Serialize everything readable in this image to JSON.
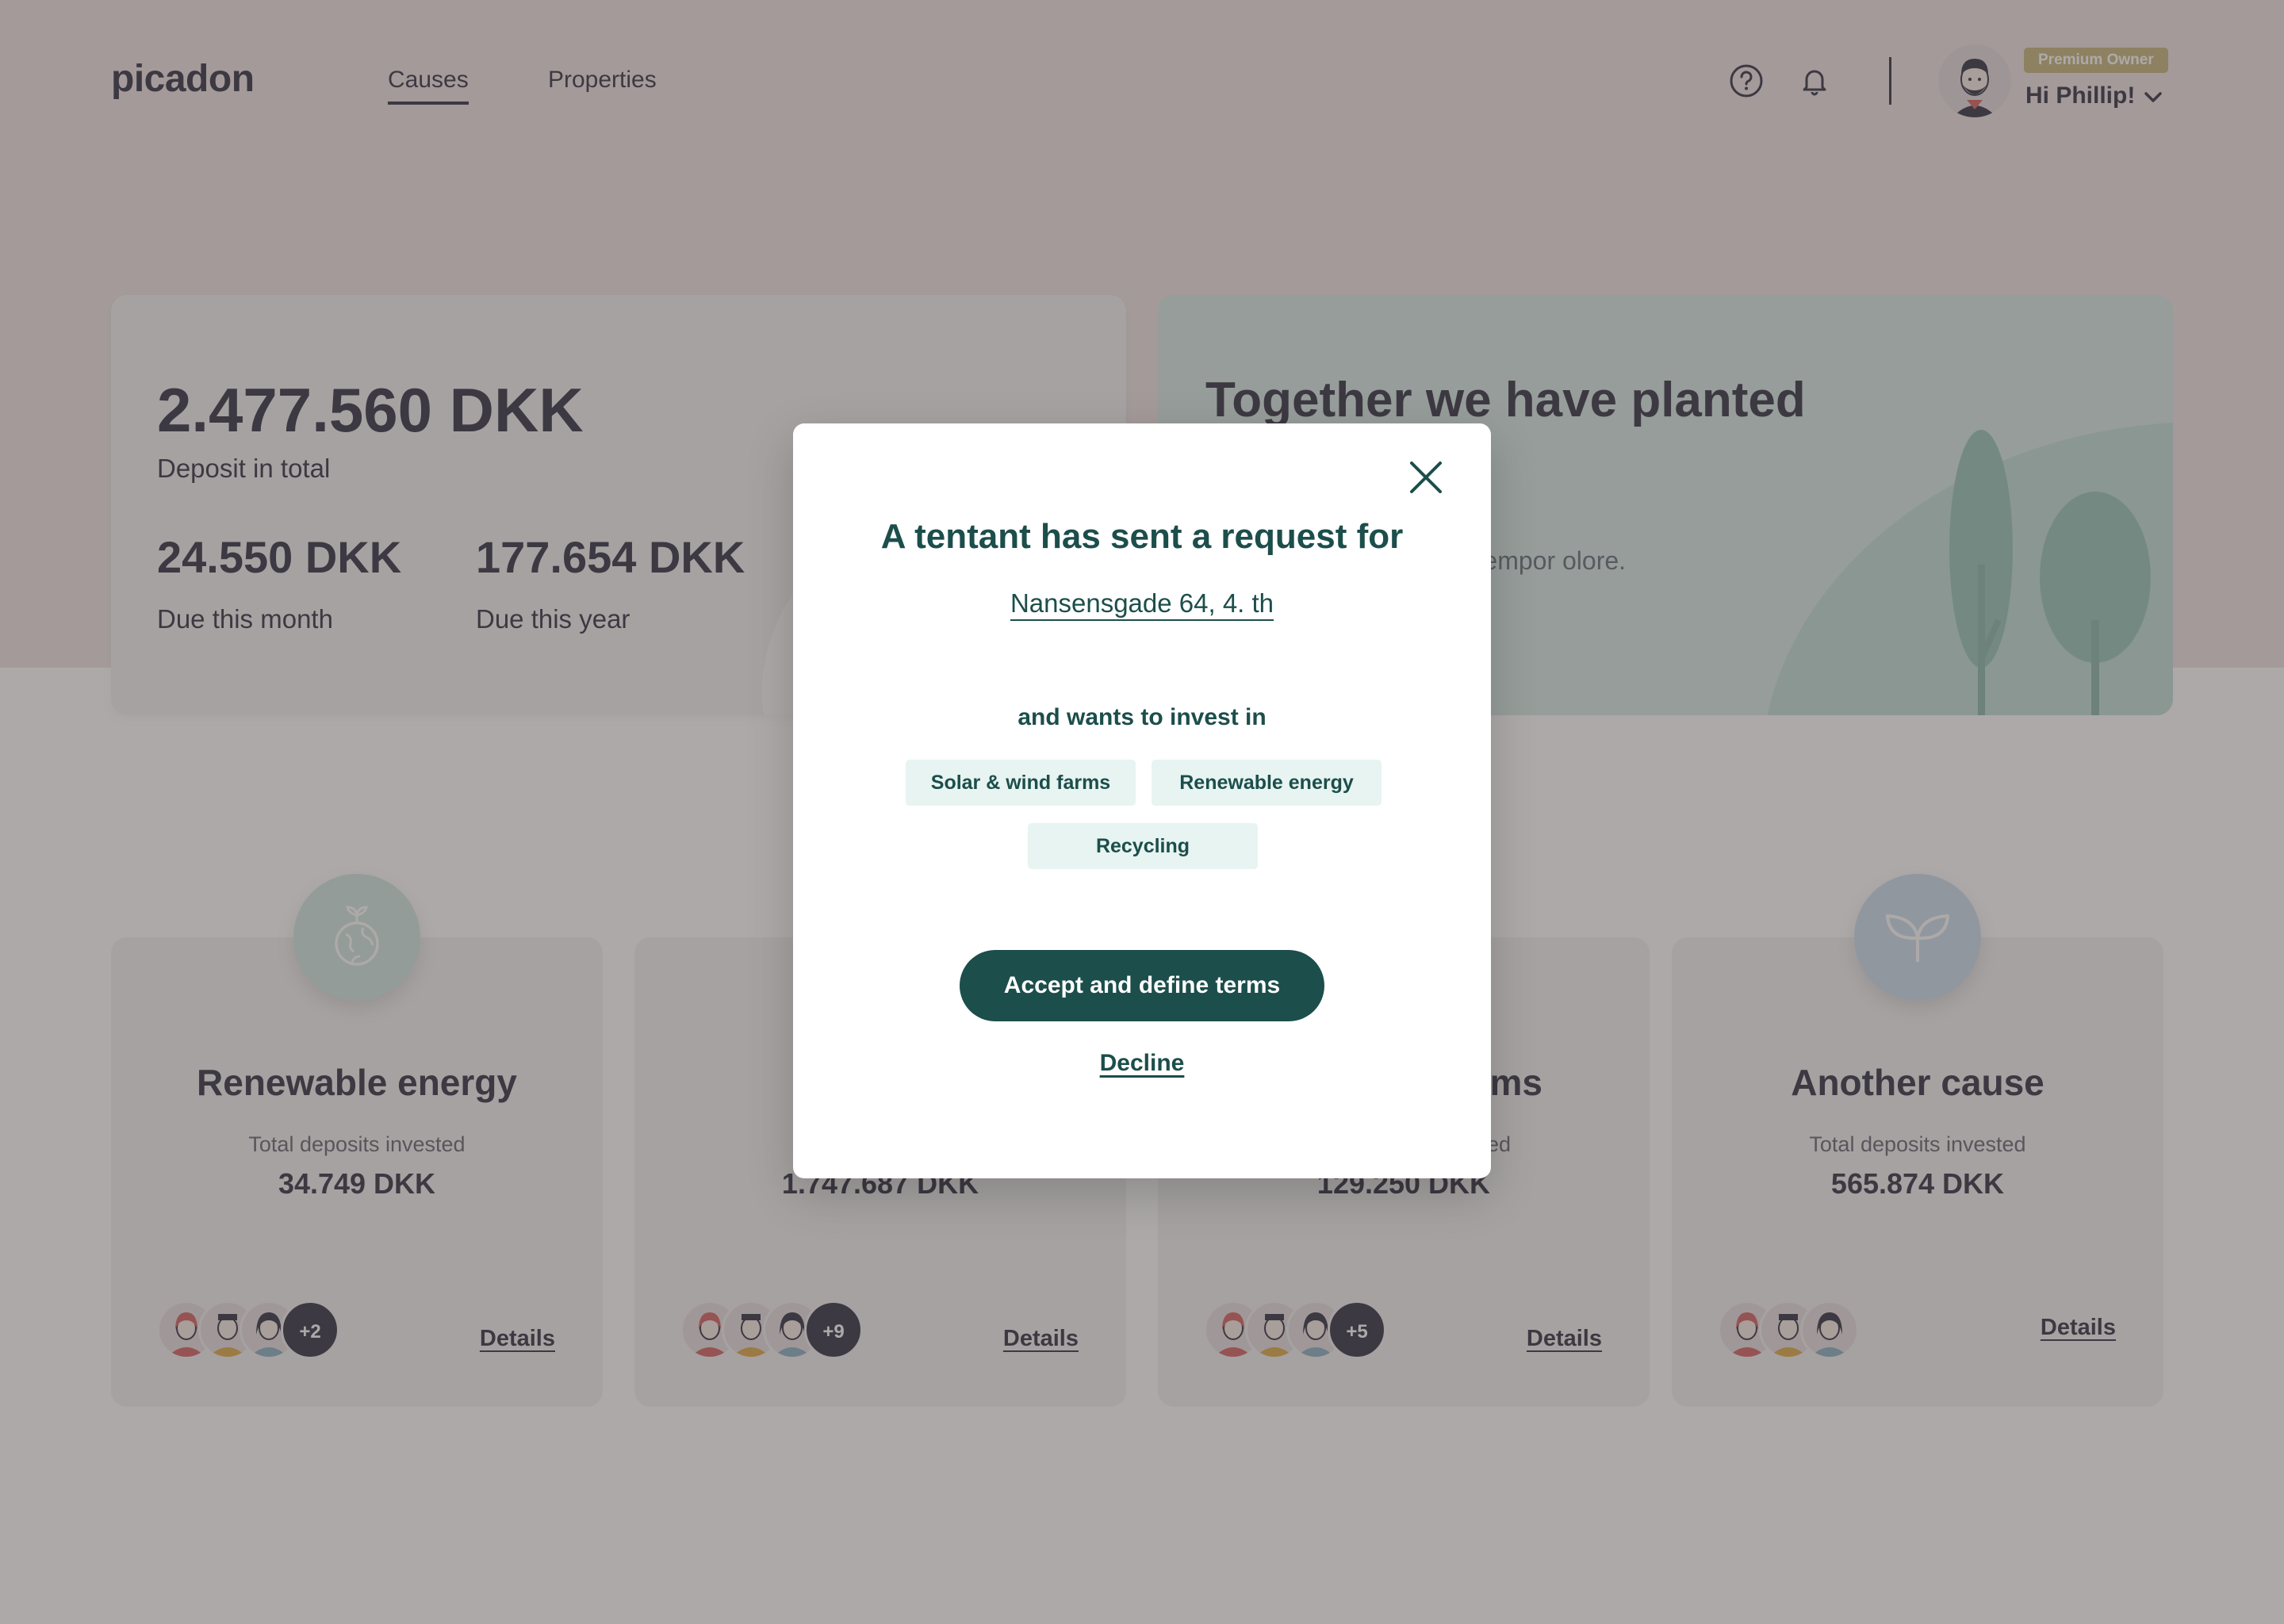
{
  "header": {
    "logo": "picadon",
    "nav": [
      {
        "label": "Causes",
        "active": true
      },
      {
        "label": "Properties",
        "active": false
      }
    ],
    "icons": [
      "help-icon",
      "bell-icon",
      "chevron-down-icon"
    ],
    "user": {
      "badge": "Premium Owner",
      "greeting": "Hi Phillip!"
    }
  },
  "stats": {
    "total_amount": "2.477.560 DKK",
    "total_label": "Deposit in total",
    "month_amount": "24.550 DKK",
    "month_label": "Due this month",
    "year_amount": "177.654 DKK",
    "year_label": "Due this year"
  },
  "trees": {
    "title": "Together we have planted  rees!",
    "text": "net, consectetur usmod tempor olore."
  },
  "causes": [
    {
      "title": "Renewable energy",
      "subtitle": "Total deposits invested",
      "amount": "34.749 DKK",
      "more": "+2",
      "details": "Details",
      "icon": "earth-sprout-icon",
      "color": "#d2e8e2"
    },
    {
      "title": "",
      "subtitle": "To",
      "amount": "1.747.687 DKK",
      "more": "+9",
      "details": "Details",
      "icon": "",
      "color": "#f3f3f3"
    },
    {
      "title": "arms",
      "subtitle": "ed",
      "amount": "129.250 DKK",
      "more": "+5",
      "details": "Details",
      "icon": "",
      "color": "#f3f3f3"
    },
    {
      "title": "Another cause",
      "subtitle": "Total deposits invested",
      "amount": "565.874 DKK",
      "more": "",
      "details": "Details",
      "icon": "leaf-sprout-icon",
      "color": "#cde0ee"
    }
  ],
  "modal": {
    "title": "A tentant has sent a request for",
    "address": "Nansensgade 64, 4. th",
    "wants_label": "and wants to invest in",
    "tags": [
      "Solar & wind farms",
      "Renewable energy",
      "Recycling"
    ],
    "accept_label": "Accept and define terms",
    "decline_label": "Decline"
  },
  "colors": {
    "brand_dark": "#1c4e4b",
    "text_dark": "#3f3f4e",
    "tag_bg": "#e7f4f1",
    "premium": "#c9bb84",
    "trees_bg": "#d8ebe6"
  }
}
